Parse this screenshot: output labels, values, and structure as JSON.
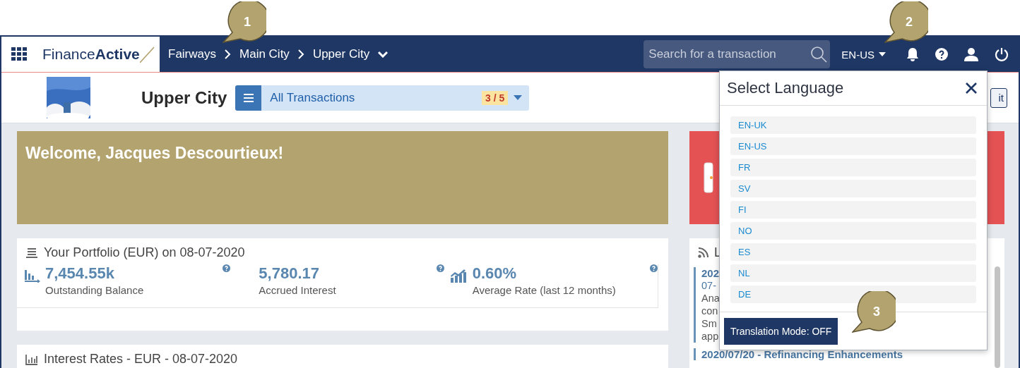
{
  "callouts": [
    {
      "number": "1"
    },
    {
      "number": "2"
    },
    {
      "number": "3"
    }
  ],
  "header": {
    "logo": "Finance**Active**",
    "breadcrumbs": [
      "Fairways",
      "Main City",
      "Upper City"
    ],
    "search": {
      "placeholder": "Search for a transaction"
    },
    "language": "EN-US"
  },
  "entity": {
    "title": "Upper City",
    "view": "All Transactions",
    "count": "3 / 5",
    "edit_button": "it"
  },
  "welcome": "Welcome, Jacques Descourtieux!",
  "portfolio": {
    "title": "Your Portfolio (EUR) on 08-07-2020",
    "metrics": [
      {
        "kind": "balance",
        "value": "7,454.55k",
        "label": "Outstanding Balance"
      },
      {
        "kind": "plain",
        "value": "5,780.17",
        "label": "Accrued Interest"
      },
      {
        "kind": "rate",
        "value": "0.60%",
        "label": "Average Rate (last 12 months)"
      }
    ]
  },
  "interest_rates": {
    "title": "Interest Rates - EUR - 08-07-2020"
  },
  "news": {
    "title": "L",
    "items": [
      {
        "title": "202",
        "lines": [
          "07-",
          "Ana",
          "con",
          "Sm",
          "app"
        ]
      },
      {
        "title": "2020/07/20 - Refinancing Enhancements"
      }
    ]
  },
  "language_panel": {
    "title": "Select Language",
    "languages": [
      "EN-UK",
      "EN-US",
      "FR",
      "SV",
      "FI",
      "NO",
      "ES",
      "NL",
      "DE"
    ],
    "translation_button": "Translation Mode: OFF"
  }
}
